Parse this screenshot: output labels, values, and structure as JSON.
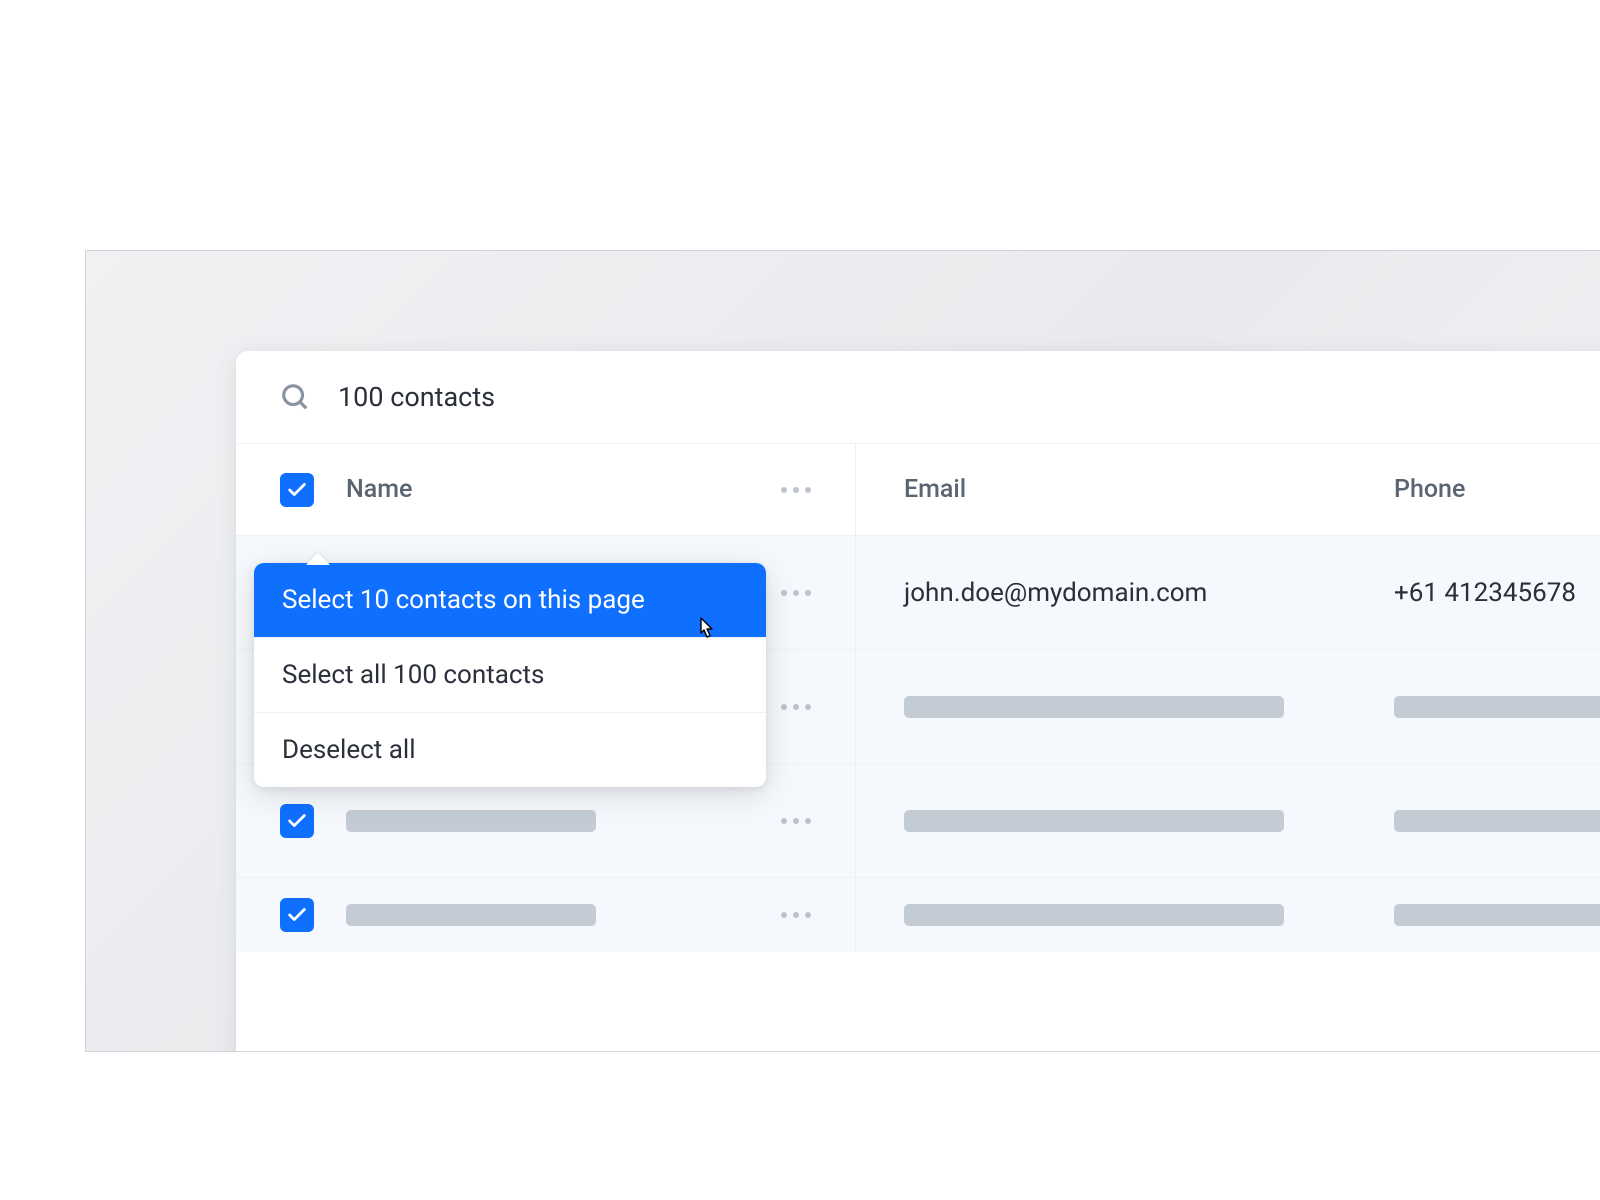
{
  "search": {
    "label": "100 contacts"
  },
  "columns": {
    "name": "Name",
    "email": "Email",
    "phone": "Phone"
  },
  "rows": [
    {
      "email": "john.doe@mydomain.com",
      "phone": "+61 412345678"
    }
  ],
  "dropdown": {
    "select_page": "Select 10 contacts on this page",
    "select_all": "Select all 100 contacts",
    "deselect": "Deselect all"
  }
}
